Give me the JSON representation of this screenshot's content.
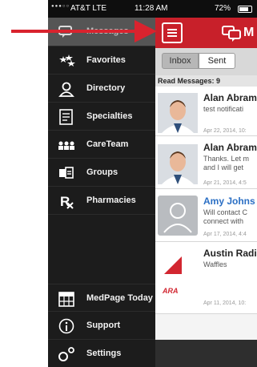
{
  "status_bar": {
    "signal": "●●●○○",
    "carrier": "AT&T LTE",
    "time": "11:28 AM",
    "battery": "72%"
  },
  "menu": {
    "items": [
      {
        "label": "Messages",
        "icon": "chat-icon"
      },
      {
        "label": "Favorites",
        "icon": "stars-icon"
      },
      {
        "label": "Directory",
        "icon": "person-icon"
      },
      {
        "label": "Specialties",
        "icon": "document-icon"
      },
      {
        "label": "CareTeam",
        "icon": "team-icon"
      },
      {
        "label": "Groups",
        "icon": "groups-icon"
      },
      {
        "label": "Pharmacies",
        "icon": "rx-icon"
      },
      {
        "label": "MedPage Today",
        "icon": "calendar-icon"
      },
      {
        "label": "Support",
        "icon": "info-icon"
      },
      {
        "label": "Settings",
        "icon": "gear-icon"
      }
    ]
  },
  "nav": {
    "logo_letter": "M",
    "brand_color": "#c8202a"
  },
  "tabs": {
    "inbox": "Inbox",
    "sent": "Sent"
  },
  "section_header": "Read Messages: 9",
  "messages": [
    {
      "name": "Alan Abram",
      "preview1": "test notificati",
      "preview2": "",
      "date": "Apr 22, 2014, 10:",
      "unread": false
    },
    {
      "name": "Alan Abram",
      "preview1": "Thanks. Let m",
      "preview2": "and I will get",
      "date": "Apr 21, 2014, 4:5",
      "unread": false
    },
    {
      "name": "Amy Johns",
      "preview1": "Will contact C",
      "preview2": "connect with",
      "date": "Apr 17, 2014, 4:4",
      "unread": true
    },
    {
      "name": "Austin Radi",
      "preview1": "Waffles",
      "preview2": "",
      "date": "Apr 11, 2014, 10:",
      "unread": false
    }
  ],
  "ara_logo_text": "ARA",
  "arrow_color": "#d9232e"
}
